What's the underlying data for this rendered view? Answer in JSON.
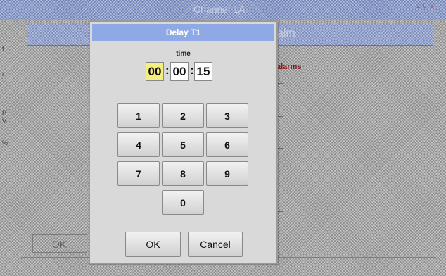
{
  "background": {
    "window_title": "Channel 1A",
    "status_indicator": "2 0 V",
    "header_title": "alm",
    "alarms_text": "alarms",
    "side_labels": [
      "f",
      "r",
      "P",
      "V",
      "%"
    ],
    "ok_label": "OK"
  },
  "dialog": {
    "title": "Delay T1",
    "time_label": "time",
    "hours": "00",
    "minutes": "00",
    "seconds": "15",
    "separator": ":",
    "keypad": [
      "1",
      "2",
      "3",
      "4",
      "5",
      "6",
      "7",
      "8",
      "9",
      "0"
    ],
    "ok_label": "OK",
    "cancel_label": "Cancel"
  },
  "colors": {
    "title_bar": "#8fa8e6",
    "active_field": "#f5ef80",
    "alarm_text": "#8a1a1a"
  }
}
